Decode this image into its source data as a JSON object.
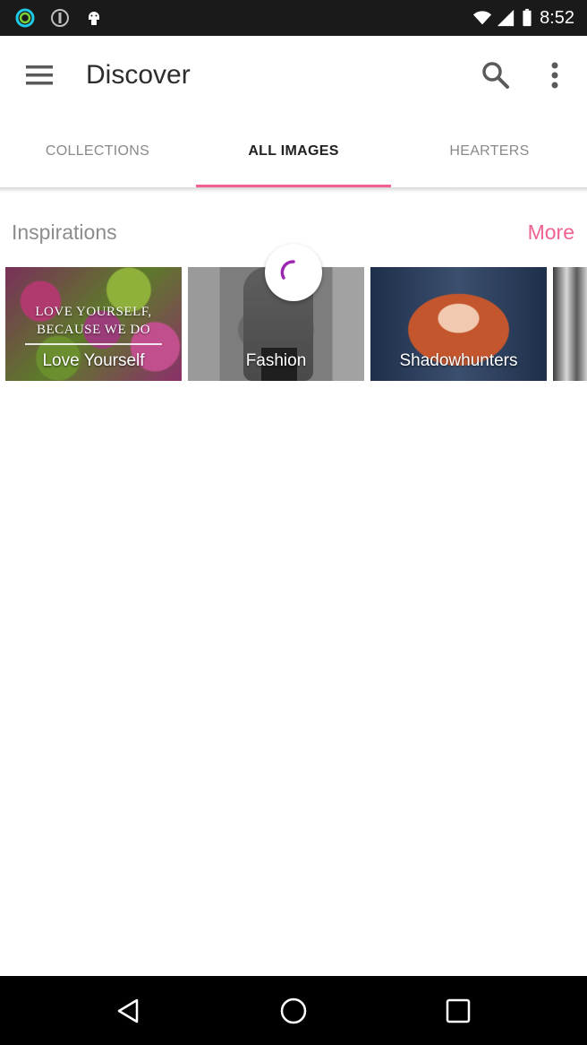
{
  "status_bar": {
    "time": "8:52",
    "icons": [
      "ring-status-icon",
      "info-status-icon",
      "android-status-icon"
    ],
    "right_icons": [
      "wifi-icon",
      "signal-icon",
      "battery-icon"
    ]
  },
  "app_bar": {
    "title": "Discover",
    "menu_icon": "hamburger-menu-icon",
    "search_icon": "search-icon",
    "overflow_icon": "more-vert-icon"
  },
  "tabs": [
    {
      "label": "COLLECTIONS",
      "active": false
    },
    {
      "label": "ALL IMAGES",
      "active": true
    },
    {
      "label": "HEARTERS",
      "active": false
    }
  ],
  "section": {
    "title": "Inspirations",
    "more_label": "More"
  },
  "cards": [
    {
      "label": "Love Yourself",
      "quote_line1": "LOVE YOURSELF,",
      "quote_line2": "BECAUSE WE DO"
    },
    {
      "label": "Fashion"
    },
    {
      "label": "Shadowhunters"
    },
    {
      "label": ""
    }
  ],
  "colors": {
    "accent": "#f06292",
    "status_bar": "#1a1a1a",
    "nav_bar": "#000000",
    "spinner": "#9c27b0"
  },
  "nav_bar": {
    "icons": [
      "back-icon",
      "home-icon",
      "recents-icon"
    ]
  }
}
